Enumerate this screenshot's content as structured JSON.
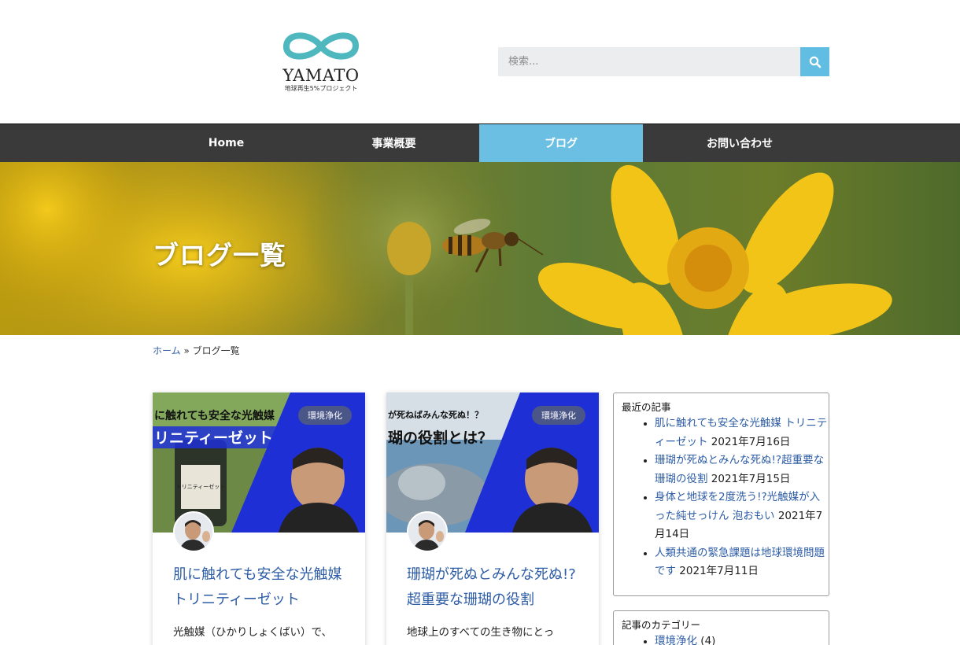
{
  "header": {
    "logo_text": "YAMATO",
    "logo_sub": "地球再生5%プロジェクト",
    "search_placeholder": "検索..."
  },
  "colors": {
    "accent": "#6bbfe3",
    "nav_bg": "#3a3a3a",
    "link": "#2e5da6"
  },
  "nav": {
    "items": [
      {
        "label": "Home",
        "active": false
      },
      {
        "label": "事業概要",
        "active": false
      },
      {
        "label": "ブログ",
        "active": true
      },
      {
        "label": "お問い合わせ",
        "active": false
      }
    ]
  },
  "hero": {
    "title": "ブログ一覧"
  },
  "breadcrumb": {
    "home": "ホーム",
    "separator": "»",
    "current": "ブログ一覧"
  },
  "posts": [
    {
      "tag": "環境浄化",
      "thumb_text_1": "に触れても安全な光触媒",
      "thumb_text_2": "リニティーゼット",
      "bottle_label": "トリニティーゼット",
      "title": "肌に触れても安全な光触媒 トリニティーゼット",
      "excerpt": "光触媒（ひかりしょくばい）で、"
    },
    {
      "tag": "環境浄化",
      "thumb_text_1": "が死ねばみんな死ぬ！？",
      "thumb_text_2": "瑚の役割とは？",
      "title": "珊瑚が死ぬとみんな死ぬ!?超重要な珊瑚の役割",
      "excerpt": "地球上のすべての生き物にとっ"
    }
  ],
  "sidebar": {
    "recent_title": "最近の記事",
    "recent": [
      {
        "title": "肌に触れても安全な光触媒 トリニティーゼット",
        "date": "2021年7月16日"
      },
      {
        "title": "珊瑚が死ぬとみんな死ぬ!?超重要な珊瑚の役割",
        "date": "2021年7月15日"
      },
      {
        "title": "身体と地球を2度洗う!?光触媒が入った純せっけん 泡おもい",
        "date": "2021年7月14日"
      },
      {
        "title": "人類共通の緊急課題は地球環境問題です",
        "date": "2021年7月11日"
      }
    ],
    "categories_title": "記事のカテゴリー",
    "categories": [
      {
        "name": "環境浄化",
        "count": "(4)"
      }
    ]
  }
}
